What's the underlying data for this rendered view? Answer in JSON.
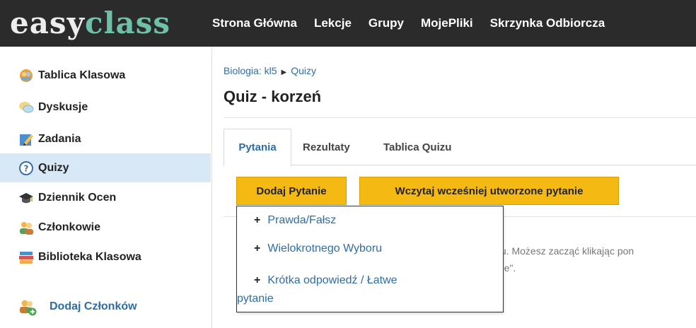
{
  "logo": {
    "part1": "easy",
    "part2": "class"
  },
  "nav": [
    "Strona Główna",
    "Lekcje",
    "Grupy",
    "MojePliki",
    "Skrzynka Odbiorcza"
  ],
  "sidebar": {
    "items": [
      {
        "label": "Tablica Klasowa",
        "icon": "class-board-icon"
      },
      {
        "label": "Dyskusje",
        "icon": "speech-bubbles-icon"
      },
      {
        "label": "Zadania",
        "icon": "assignment-pencil-icon"
      },
      {
        "label": "Quizy",
        "icon": "quiz-question-icon"
      },
      {
        "label": "Dziennik Ocen",
        "icon": "graduation-cap-icon"
      },
      {
        "label": "Członkowie",
        "icon": "members-icon"
      },
      {
        "label": "Biblioteka Klasowa",
        "icon": "books-icon"
      }
    ],
    "add_members": "Dodaj Członków"
  },
  "breadcrumb": {
    "parent": "Biologia: kl5",
    "current": "Quizy"
  },
  "page_title": "Quiz - korzeń",
  "tabs": [
    "Pytania",
    "Rezultaty",
    "Tablica Quizu"
  ],
  "buttons": {
    "add_question": "Dodaj Pytanie",
    "load_question": "Wczytaj wcześniej utworzone pytanie"
  },
  "background_text": {
    "line1": "uizu. Możesz zacząć klikając pon",
    "line2": "tanie\"."
  },
  "dropdown": {
    "items": [
      "Prawda/Fałsz",
      "Wielokrotnego Wyboru"
    ],
    "item3_line1": "Krótka odpowiedź / Łatwe",
    "item3_line2": "pytanie"
  },
  "colors": {
    "topbar": "#2b2b2b",
    "accent": "#2d6ea8",
    "button": "#f5b914",
    "active_bg": "#d8e8f6"
  }
}
